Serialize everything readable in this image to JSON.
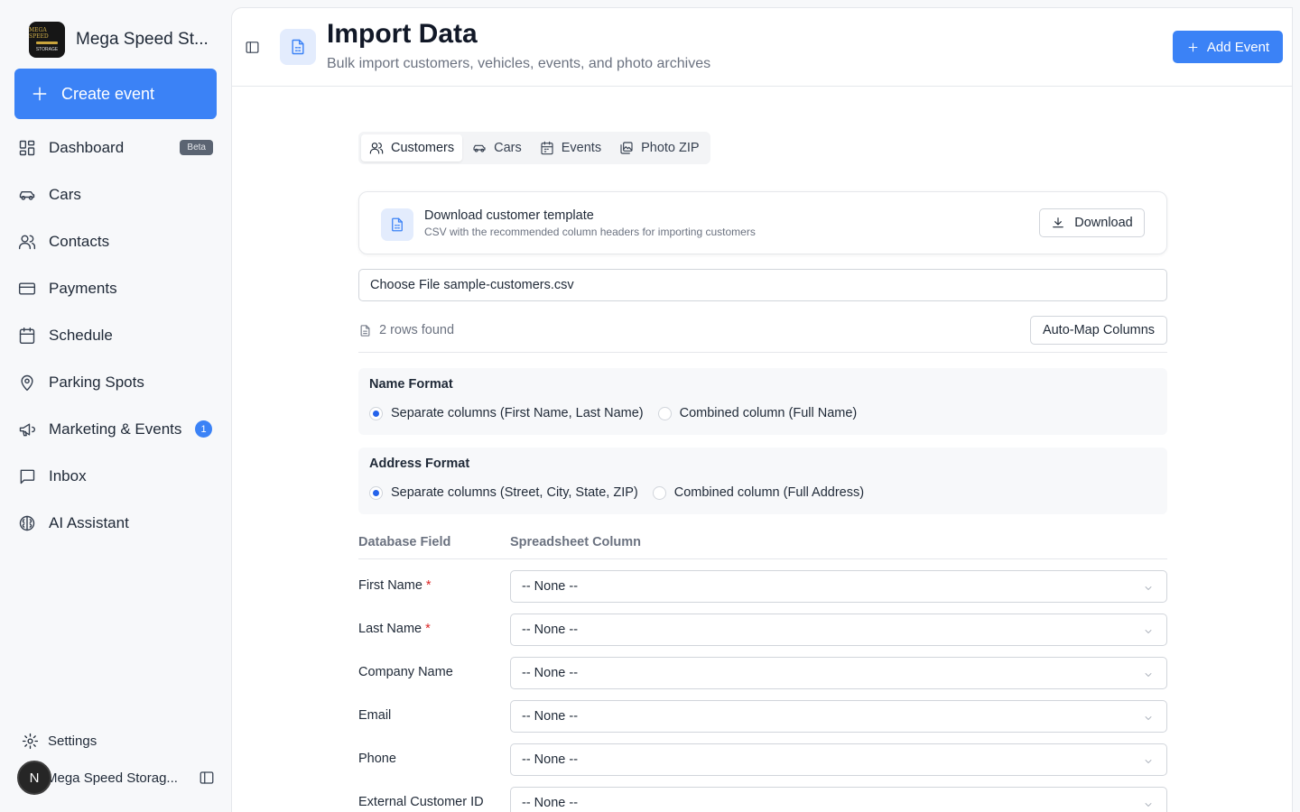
{
  "brand": {
    "name": "Mega Speed St...",
    "logo_text_top": "MEGA SPEED",
    "logo_text_bottom": "STORAGE"
  },
  "sidebar": {
    "create_label": "Create event",
    "items": [
      {
        "label": "Dashboard",
        "icon": "dashboard-icon",
        "badge": "Beta"
      },
      {
        "label": "Cars",
        "icon": "car-icon"
      },
      {
        "label": "Contacts",
        "icon": "users-icon"
      },
      {
        "label": "Payments",
        "icon": "credit-card-icon"
      },
      {
        "label": "Schedule",
        "icon": "calendar-icon"
      },
      {
        "label": "Parking Spots",
        "icon": "map-pin-icon"
      },
      {
        "label": "Marketing & Events",
        "icon": "megaphone-icon",
        "count": "1"
      },
      {
        "label": "Inbox",
        "icon": "message-square-icon"
      },
      {
        "label": "AI Assistant",
        "icon": "brain-icon"
      }
    ],
    "settings_label": "Settings",
    "user_initial": "N",
    "user_name": "Mega Speed Storag..."
  },
  "header": {
    "title": "Import Data",
    "subtitle": "Bulk import customers, vehicles, events, and photo archives",
    "add_event_label": "Add Event"
  },
  "tabs": [
    {
      "label": "Customers",
      "icon": "users-icon",
      "active": true
    },
    {
      "label": "Cars",
      "icon": "car-icon"
    },
    {
      "label": "Events",
      "icon": "calendar-icon"
    },
    {
      "label": "Photo ZIP",
      "icon": "images-icon"
    }
  ],
  "template": {
    "title": "Download customer template",
    "subtitle": "CSV with the recommended column headers for importing customers",
    "download_label": "Download"
  },
  "file": {
    "button_label": "Choose File",
    "file_name": "sample-customers.csv"
  },
  "rows_found": "2 rows found",
  "automap_label": "Auto-Map Columns",
  "name_format": {
    "title": "Name Format",
    "options": [
      "Separate columns (First Name, Last Name)",
      "Combined column (Full Name)"
    ],
    "selected": 0
  },
  "address_format": {
    "title": "Address Format",
    "options": [
      "Separate columns (Street, City, State, ZIP)",
      "Combined column (Full Address)"
    ],
    "selected": 0
  },
  "mapping": {
    "col_db": "Database Field",
    "col_sheet": "Spreadsheet Column",
    "rows": [
      {
        "field": "First Name",
        "required": "*",
        "value": "-- None --"
      },
      {
        "field": "Last Name",
        "required": "*",
        "value": "-- None --"
      },
      {
        "field": "Company Name",
        "value": "-- None --"
      },
      {
        "field": "Email",
        "value": "-- None --"
      },
      {
        "field": "Phone",
        "value": "-- None --"
      },
      {
        "field": "External Customer ID",
        "value": "-- None --"
      }
    ]
  },
  "colors": {
    "accent": "#3b82f6",
    "required": "#dc2626",
    "badge_beta_bg": "#5b6472"
  }
}
